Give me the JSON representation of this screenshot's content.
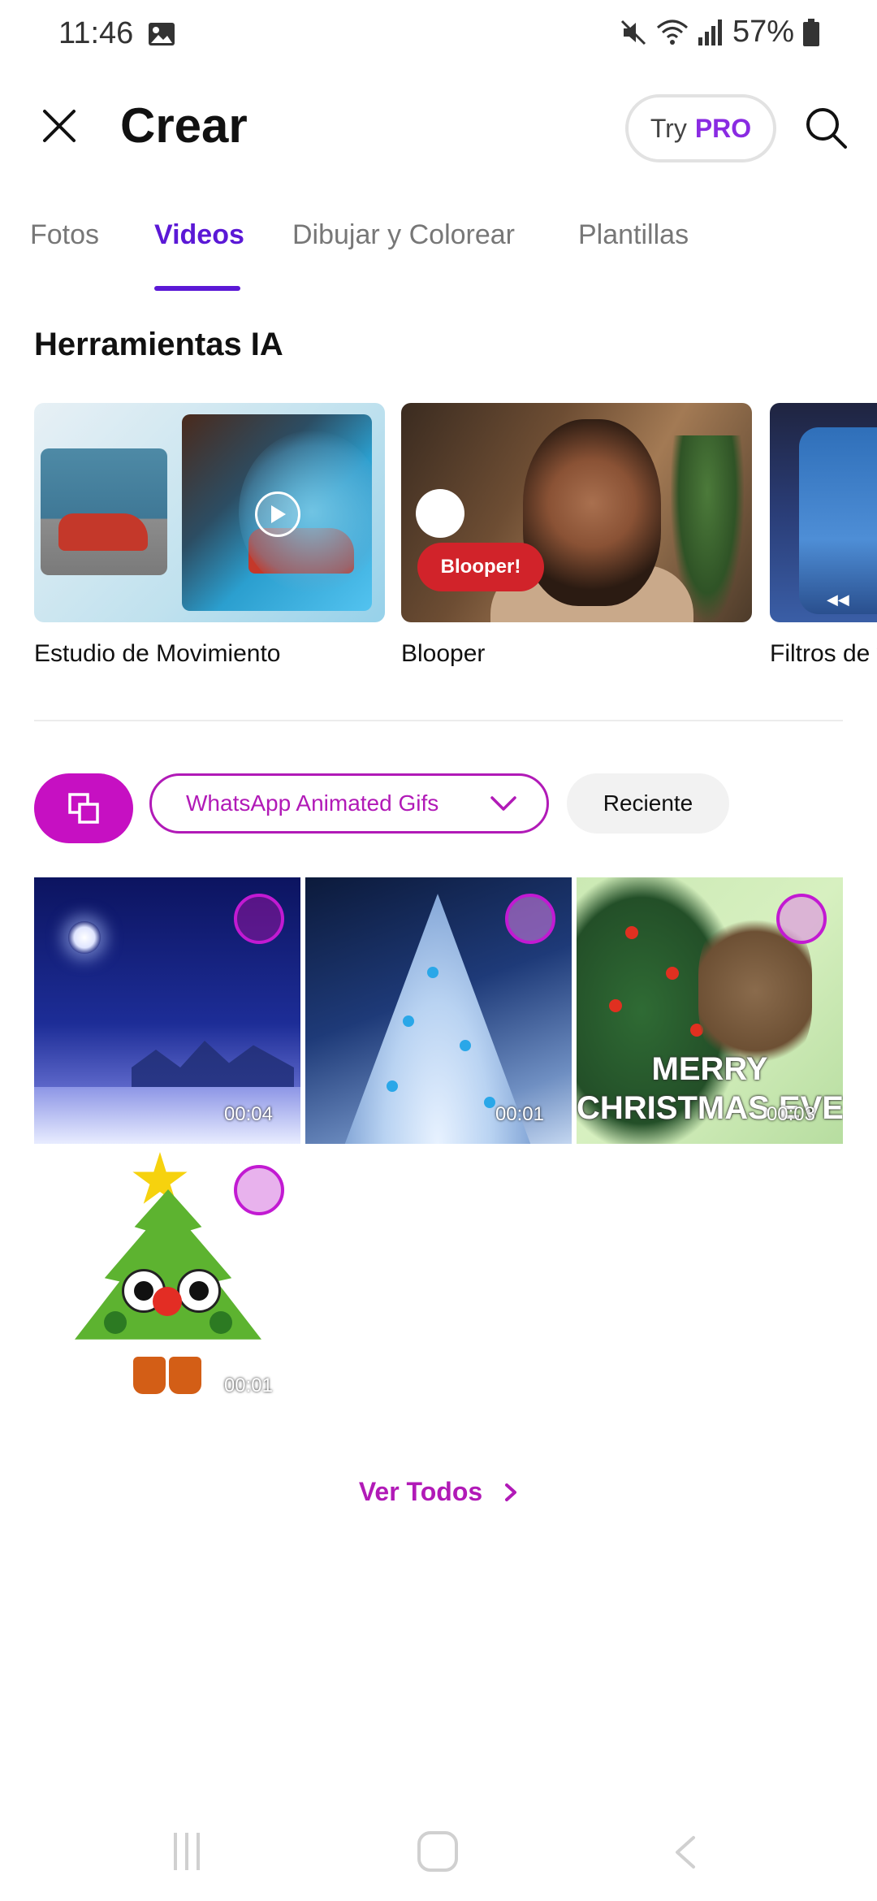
{
  "status_bar": {
    "time": "11:46",
    "battery": "57%",
    "icons": [
      "image-icon",
      "mute-icon",
      "wifi-icon",
      "signal-icon",
      "battery-icon"
    ]
  },
  "header": {
    "title": "Crear",
    "try_label": "Try",
    "pro_label": "PRO"
  },
  "tabs": [
    {
      "label": "Fotos",
      "active": false
    },
    {
      "label": "Videos",
      "active": true
    },
    {
      "label": "Dibujar y Colorear",
      "active": false
    },
    {
      "label": "Plantillas",
      "active": false
    }
  ],
  "ai_tools": {
    "title": "Herramientas IA",
    "cards": [
      {
        "label": "Estudio de Movimiento"
      },
      {
        "label": "Blooper",
        "badge": "Blooper!"
      },
      {
        "label": "Filtros de v"
      }
    ]
  },
  "filters": {
    "album": "WhatsApp Animated Gifs",
    "sort": "Reciente"
  },
  "gallery": {
    "items": [
      {
        "duration": "00:04"
      },
      {
        "duration": "00:01"
      },
      {
        "duration": "00:03",
        "overlay_text_line1": "MERRY",
        "overlay_text_line2": "CHRISTMAS EVE"
      },
      {
        "duration": "00:01"
      }
    ]
  },
  "see_all": {
    "label": "Ver Todos"
  },
  "colors": {
    "accent_tab": "#5b18d6",
    "accent_magenta": "#b11ab7",
    "select_button": "#c610c2",
    "blooper_badge": "#d1232a"
  }
}
